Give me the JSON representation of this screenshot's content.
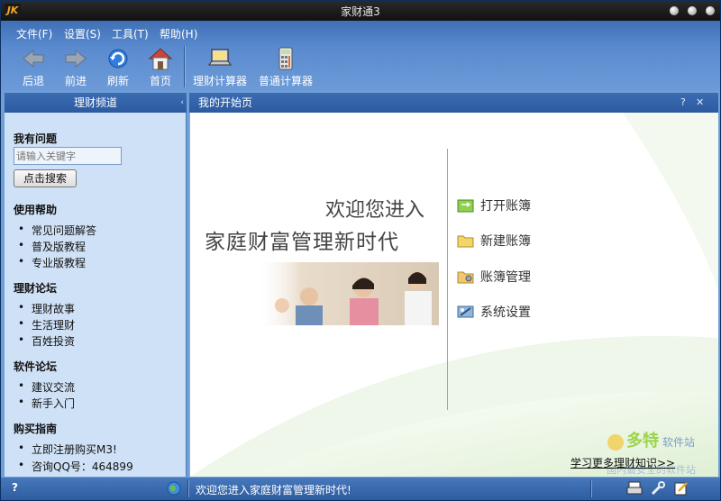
{
  "window": {
    "title": "家财通3",
    "logo_text": "JK"
  },
  "menu": [
    {
      "label": "文件(F)"
    },
    {
      "label": "设置(S)"
    },
    {
      "label": "工具(T)"
    },
    {
      "label": "帮助(H)"
    }
  ],
  "toolbar": {
    "back": "后退",
    "forward": "前进",
    "refresh": "刷新",
    "home": "首页",
    "finance_calc": "理财计算器",
    "normal_calc": "普通计算器"
  },
  "left_panel": {
    "header": "理财频道",
    "collapse_glyph": "‹",
    "sections": {
      "question": {
        "title": "我有问题"
      },
      "help": {
        "title": "使用帮助",
        "items": [
          "常见问题解答",
          "普及版教程",
          "专业版教程"
        ]
      },
      "forum": {
        "title": "理财论坛",
        "items": [
          "理财故事",
          "生活理财",
          "百姓投资"
        ]
      },
      "software": {
        "title": "软件论坛",
        "items": [
          "建议交流",
          "新手入门"
        ]
      },
      "buy": {
        "title": "购买指南",
        "items": [
          "立即注册购买M3!",
          "咨询QQ号：464899"
        ]
      }
    },
    "search": {
      "placeholder": "请输入关键字",
      "button": "点击搜索"
    }
  },
  "right_panel": {
    "header": "我的开始页",
    "help_glyph": "?",
    "close_glyph": "✕",
    "welcome_line1": "欢迎您进入",
    "welcome_line2": "家庭财富管理新时代",
    "actions": [
      {
        "label": "打开账簿",
        "icon": "open-book-icon"
      },
      {
        "label": "新建账簿",
        "icon": "new-folder-icon"
      },
      {
        "label": "账簿管理",
        "icon": "book-manage-icon"
      },
      {
        "label": "系统设置",
        "icon": "settings-icon"
      }
    ],
    "learn_more": "学习更多理财知识>>",
    "watermark_brand": "多特",
    "watermark_sub": "软件站",
    "watermark_line": "国内最安全的软件站"
  },
  "statusbar": {
    "help": "?",
    "message": "欢迎您进入家庭财富管理新时代!"
  },
  "colors": {
    "toolbar_blue": "#5b8bcf",
    "panel_header": "#2c5aa0",
    "left_bg": "#cfe1f6",
    "accent_green": "#9bd34a"
  }
}
